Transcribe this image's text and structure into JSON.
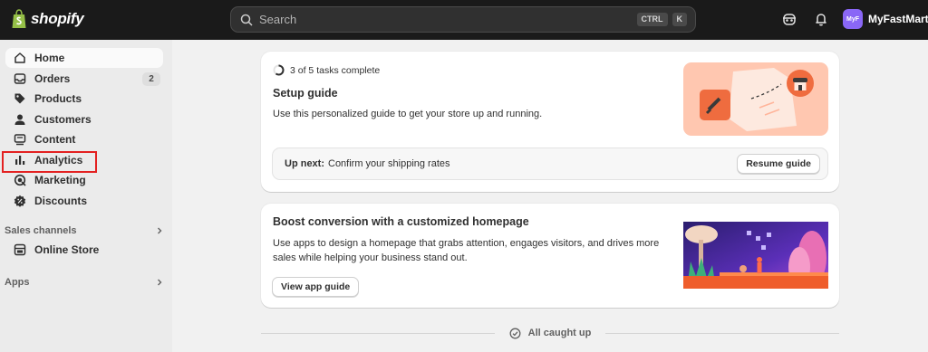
{
  "topbar": {
    "logo_text": "shopify",
    "search_placeholder": "Search",
    "shortcut_keys": [
      "CTRL",
      "K"
    ],
    "store_avatar": "MyF",
    "store_name": "MyFastMart",
    "icons": [
      "search-icon",
      "sidekick-icon",
      "bell-icon"
    ]
  },
  "sidebar": {
    "items": [
      {
        "label": "Home",
        "icon": "home-icon",
        "active": true
      },
      {
        "label": "Orders",
        "icon": "inbox-icon",
        "badge": "2"
      },
      {
        "label": "Products",
        "icon": "tag-icon"
      },
      {
        "label": "Customers",
        "icon": "person-icon"
      },
      {
        "label": "Content",
        "icon": "content-icon"
      },
      {
        "label": "Analytics",
        "icon": "bar-chart-icon",
        "highlighted": true
      },
      {
        "label": "Marketing",
        "icon": "target-icon"
      },
      {
        "label": "Discounts",
        "icon": "discount-icon"
      }
    ],
    "sales_channels": {
      "label": "Sales channels",
      "items": [
        {
          "label": "Online Store",
          "icon": "store-icon"
        }
      ]
    },
    "apps": {
      "label": "Apps"
    }
  },
  "setup_guide": {
    "progress_text": "3 of 5 tasks complete",
    "progress_done": 3,
    "progress_total": 5,
    "title": "Setup guide",
    "description": "Use this personalized guide to get your store up and running.",
    "up_next_label": "Up next:",
    "up_next_value": "Confirm your shipping rates",
    "resume_button": "Resume guide"
  },
  "homepage_card": {
    "title": "Boost conversion with a customized homepage",
    "description_line1": "Use apps to design a homepage that grabs attention, engages visitors, and drives more",
    "description_line2": "sales while helping your business stand out.",
    "button": "View app guide"
  },
  "footer": {
    "caught_up_text": "All caught up"
  },
  "colors": {
    "topbar": "#1a1a1a",
    "sidebar": "#ebebeb",
    "background": "#f1f1f1",
    "highlight_box": "#e32121",
    "avatar": "#8a67f6"
  }
}
